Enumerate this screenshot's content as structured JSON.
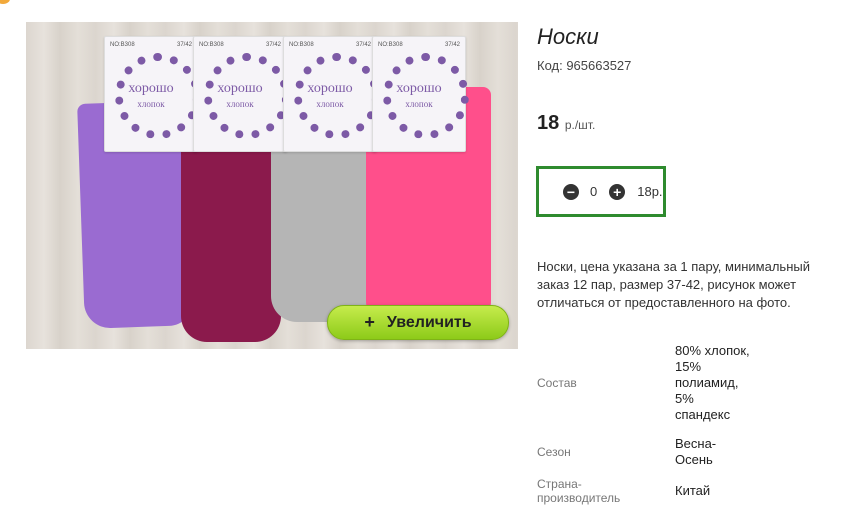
{
  "photo": {
    "tags": [
      {
        "code": "NO:B308",
        "size": "37/42",
        "brand": "хорошо",
        "sub": "хлопок"
      },
      {
        "code": "NO:B308",
        "size": "37/42",
        "brand": "хорошо",
        "sub": "хлопок"
      },
      {
        "code": "NO:B308",
        "size": "37/42",
        "brand": "хорошо",
        "sub": "хлопок"
      },
      {
        "code": "NO:B308",
        "size": "37/42",
        "brand": "хорошо",
        "sub": "хлопок"
      }
    ],
    "zoom_label": "Увеличить",
    "zoom_icon": "+"
  },
  "product": {
    "title": "Носки",
    "code": "Код: 965663527",
    "price": "18",
    "price_unit": "р./шт.",
    "description": "Носки, цена указана за 1 пару, минимальный заказ 12 пар, размер 37-42, рисунок может отличаться от предоставленного на фото."
  },
  "cart": {
    "minus_icon": "−",
    "plus_icon": "+",
    "quantity": "0",
    "sum": "18р."
  },
  "specs": [
    {
      "key": "Состав",
      "value": "80% хлопок, 15% полиамид, 5% спандекс"
    },
    {
      "key": "Сезон",
      "value": "Весна-Осень"
    },
    {
      "key": "Страна-производитель",
      "value": "Китай"
    }
  ],
  "colors": {
    "accent_border": "#2e8b2e",
    "zoom_button": "#a6d92c"
  }
}
